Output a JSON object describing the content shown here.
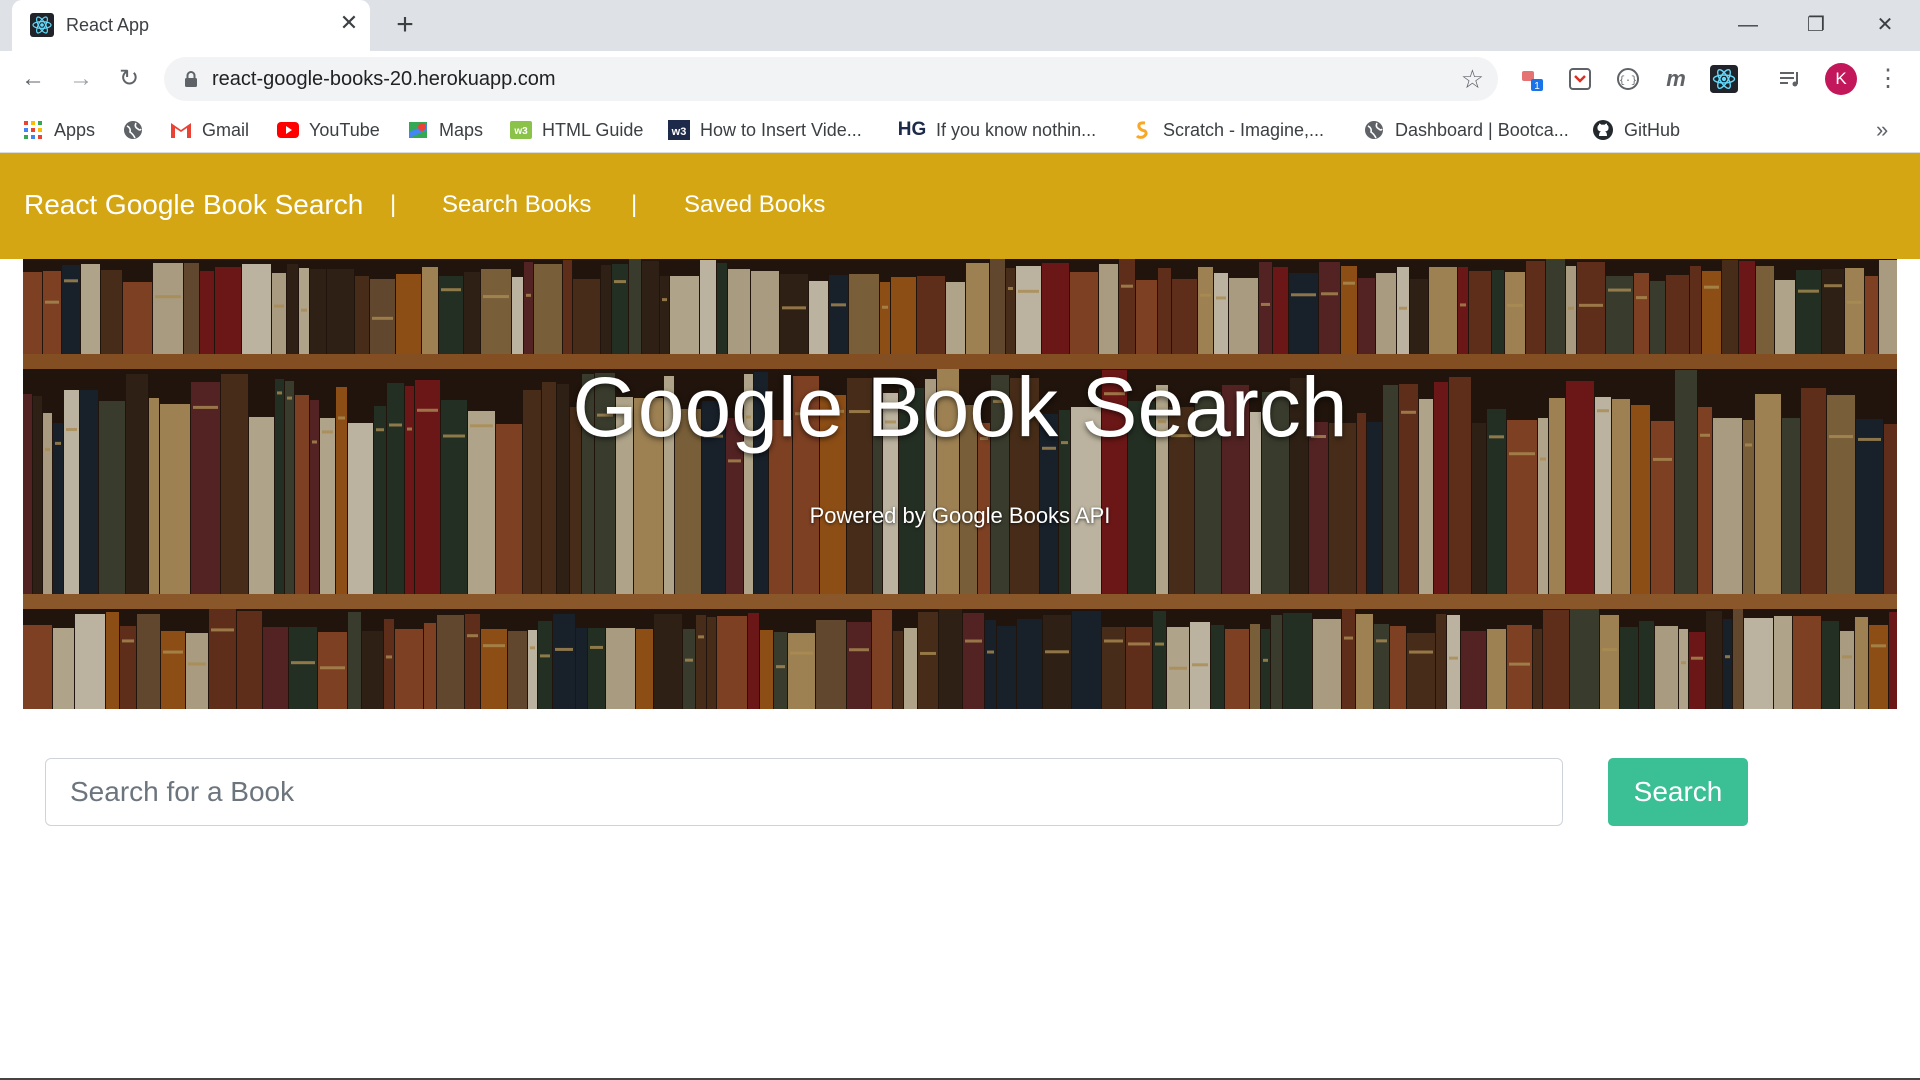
{
  "browser": {
    "tab_title": "React App",
    "tab_close": "✕",
    "new_tab": "+",
    "url": "react-google-books-20.herokuapp.com",
    "profile_initial": "K",
    "window_controls": {
      "minimize": "—",
      "restore": "❐",
      "close": "✕"
    }
  },
  "bookmarks": [
    {
      "label": "Apps",
      "icon": "apps-grid-icon"
    },
    {
      "label": "",
      "icon": "globe-icon"
    },
    {
      "label": "Gmail",
      "icon": "gmail-icon"
    },
    {
      "label": "YouTube",
      "icon": "youtube-icon"
    },
    {
      "label": "Maps",
      "icon": "maps-icon"
    },
    {
      "label": "HTML Guide",
      "icon": "w3-icon"
    },
    {
      "label": "How to Insert Vide...",
      "icon": "w3schools-icon"
    },
    {
      "label": "If you know nothin...",
      "icon": "hg-icon"
    },
    {
      "label": "Scratch - Imagine,...",
      "icon": "scratch-icon"
    },
    {
      "label": "Dashboard | Bootca...",
      "icon": "globe-icon"
    },
    {
      "label": "GitHub",
      "icon": "github-icon"
    }
  ],
  "navbar": {
    "brand": "React Google Book Search",
    "separator": "|",
    "links": [
      "Search Books",
      "Saved Books"
    ]
  },
  "hero": {
    "title": "Google Book Search",
    "subtitle": "Powered by Google Books API"
  },
  "search": {
    "placeholder": "Search for a Book",
    "button_label": "Search"
  },
  "colors": {
    "navbar": "#d4a613",
    "search_button": "#3bbf94",
    "profile": "#c2185b"
  }
}
